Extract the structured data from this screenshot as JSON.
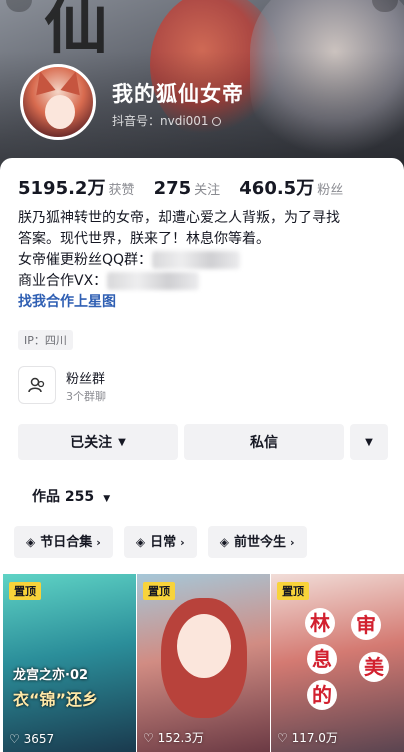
{
  "header": {
    "username": "我的狐仙女帝",
    "douyin_id": "抖音号：nvdi001"
  },
  "stats": [
    {
      "num": "5195.2万",
      "label": "获赞"
    },
    {
      "num": "275",
      "label": "关注"
    },
    {
      "num": "460.5万",
      "label": "粉丝"
    }
  ],
  "bio": {
    "line1": "朕乃狐神转世的女帝，却遭心爱之人背叛，为了寻找",
    "line2": "答案。现代世界，朕来了！林息你等着。",
    "qq_label": "女帝催更粉丝QQ群：",
    "vx_label": "商业合作VX：",
    "star_link": "找我合作上星图"
  },
  "ip_tag": "IP：四川",
  "fans_group": {
    "title": "粉丝群",
    "subtitle": "3个群聊"
  },
  "actions": {
    "follow": "已关注",
    "message": "私信"
  },
  "works": {
    "label": "作品 255"
  },
  "collections": [
    {
      "label": "节日合集"
    },
    {
      "label": "日常"
    },
    {
      "label": "前世今生"
    }
  ],
  "tiles": [
    {
      "pin": "置顶",
      "likes": "3657",
      "title1": "龙宫之亦·02",
      "title2": "衣“锦”还乡"
    },
    {
      "pin": "置顶",
      "likes": "152.3万"
    },
    {
      "pin": "置顶",
      "likes": "117.0万",
      "words": [
        "林",
        "息",
        "的",
        "审",
        "美"
      ]
    }
  ],
  "colors": {
    "accent_link": "#2f5fb3",
    "pin_bg": "#f8d33a",
    "muted": "#8a8b91"
  }
}
